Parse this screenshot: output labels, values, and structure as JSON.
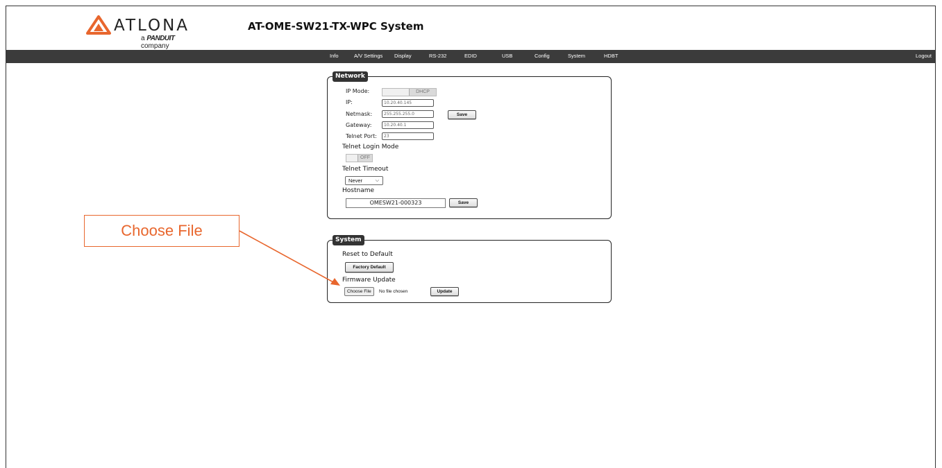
{
  "brand": {
    "logo_text": "ATLONA",
    "tagline_prefix": "a",
    "tagline_brand": "PANDUIT",
    "tagline_suffix": "company",
    "accent_color": "#e8662d"
  },
  "page_title": "AT-OME-SW21-TX-WPC  System",
  "nav": {
    "items": [
      "Info",
      "A/V Settings",
      "Display",
      "RS-232",
      "EDID",
      "USB",
      "Config",
      "System",
      "HDBT"
    ],
    "logout": "Logout"
  },
  "network": {
    "legend": "Network",
    "ip_mode_label": "IP Mode:",
    "ip_mode_value": "DHCP",
    "ip_label": "IP:",
    "ip_value": "10.20.40.145",
    "netmask_label": "Netmask:",
    "netmask_value": "255.255.255.0",
    "gateway_label": "Gateway:",
    "gateway_value": "10.20.40.1",
    "telnet_port_label": "Telnet Port:",
    "telnet_port_value": "23",
    "save_label": "Save",
    "telnet_login_mode_label": "Telnet Login Mode",
    "telnet_login_mode_value": "OFF",
    "telnet_timeout_label": "Telnet Timeout",
    "telnet_timeout_value": "Never",
    "hostname_label": "Hostname",
    "hostname_value": "OMESW21-000323",
    "hostname_save_label": "Save"
  },
  "system": {
    "legend": "System",
    "reset_label": "Reset to Default",
    "factory_default_label": "Factory Default",
    "firmware_label": "Firmware Update",
    "choose_file_label": "Choose File",
    "no_file_text": "No file chosen",
    "update_label": "Update"
  },
  "callout": {
    "text": "Choose File"
  }
}
